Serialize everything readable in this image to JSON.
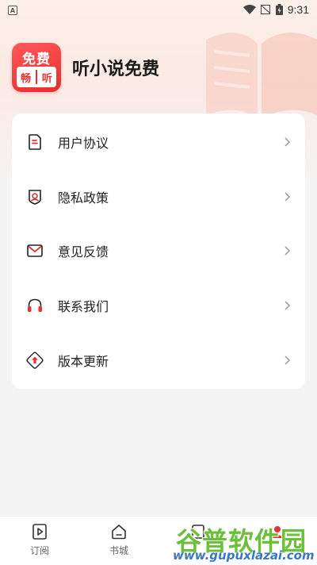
{
  "status_bar": {
    "notification": "A",
    "time": "9:31"
  },
  "header": {
    "logo_top": "免费",
    "logo_left": "畅",
    "logo_right": "听",
    "title": "听小说免费"
  },
  "menu": {
    "items": [
      {
        "label": "用户协议",
        "icon": "document-icon"
      },
      {
        "label": "隐私政策",
        "icon": "privacy-shield-icon"
      },
      {
        "label": "意见反馈",
        "icon": "mail-icon"
      },
      {
        "label": "联系我们",
        "icon": "headset-icon"
      },
      {
        "label": "版本更新",
        "icon": "upload-update-icon"
      }
    ]
  },
  "tabs": [
    {
      "label": "订阅",
      "icon": "play-book-icon"
    },
    {
      "label": "书城",
      "icon": "home-icon"
    },
    {
      "label": "",
      "icon": "hidden-icon"
    },
    {
      "label": "",
      "icon": "profile-icon"
    }
  ],
  "watermark": {
    "main": "谷普软件园",
    "url": "www.gupuxlazai.com"
  },
  "colors": {
    "accent": "#e83232",
    "background": "#f4f4f4",
    "card": "#ffffff"
  }
}
